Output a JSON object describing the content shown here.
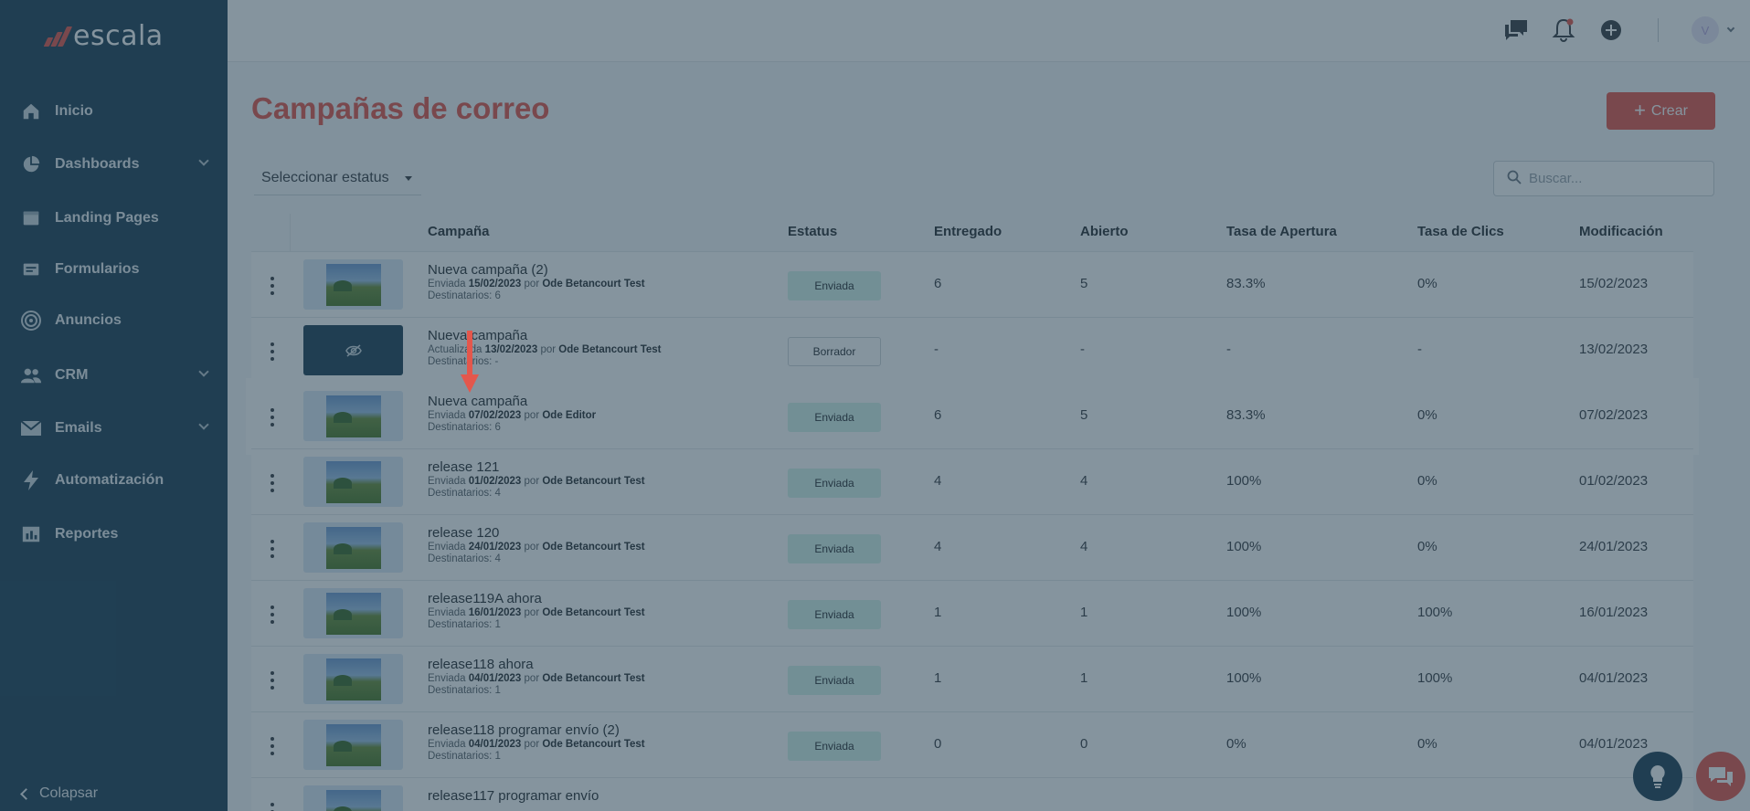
{
  "brand": {
    "name": "escala"
  },
  "sidebar": {
    "items": [
      {
        "label": "Inicio",
        "icon": "home-icon",
        "has_children": false
      },
      {
        "label": "Dashboards",
        "icon": "pie-chart-icon",
        "has_children": true
      },
      {
        "label": "Landing Pages",
        "icon": "browser-window-icon",
        "has_children": false
      },
      {
        "label": "Formularios",
        "icon": "form-icon",
        "has_children": false
      },
      {
        "label": "Anuncios",
        "icon": "target-icon",
        "has_children": false
      },
      {
        "label": "CRM",
        "icon": "people-icon",
        "has_children": true
      },
      {
        "label": "Emails",
        "icon": "envelope-icon",
        "has_children": true
      },
      {
        "label": "Automatización",
        "icon": "lightning-icon",
        "has_children": false
      },
      {
        "label": "Reportes",
        "icon": "bar-report-icon",
        "has_children": false
      }
    ],
    "collapse_label": "Colapsar"
  },
  "header": {
    "avatar_initial": "V"
  },
  "page": {
    "title": "Campañas de correo",
    "create_label": "Crear",
    "status_filter": "Seleccionar estatus",
    "search_placeholder": "Buscar..."
  },
  "table": {
    "columns": [
      "Campaña",
      "Estatus",
      "Entregado",
      "Abierto",
      "Tasa de Apertura",
      "Tasa de Clics",
      "Modificación"
    ],
    "rows": [
      {
        "name": "Nueva campaña (2)",
        "action": "Enviada",
        "date": "15/02/2023",
        "by": "por",
        "author": "Ode Betancourt Test",
        "recipients": "Destinatarios: 6",
        "status": "Enviada",
        "delivered": "6",
        "opened": "5",
        "open_rate": "83.3%",
        "click_rate": "0%",
        "modified": "15/02/2023"
      },
      {
        "name": "Nueva campaña",
        "action": "Actualizada",
        "date": "13/02/2023",
        "by": "por",
        "author": "Ode Betancourt Test",
        "recipients": "Destinatarios: -",
        "status": "Borrador",
        "delivered": "-",
        "opened": "-",
        "open_rate": "-",
        "click_rate": "-",
        "modified": "13/02/2023"
      },
      {
        "name": "Nueva campaña",
        "action": "Enviada",
        "date": "07/02/2023",
        "by": "por",
        "author": "Ode Editor",
        "recipients": "Destinatarios: 6",
        "status": "Enviada",
        "delivered": "6",
        "opened": "5",
        "open_rate": "83.3%",
        "click_rate": "0%",
        "modified": "07/02/2023"
      },
      {
        "name": "release 121",
        "action": "Enviada",
        "date": "01/02/2023",
        "by": "por",
        "author": "Ode Betancourt Test",
        "recipients": "Destinatarios: 4",
        "status": "Enviada",
        "delivered": "4",
        "opened": "4",
        "open_rate": "100%",
        "click_rate": "0%",
        "modified": "01/02/2023"
      },
      {
        "name": "release 120",
        "action": "Enviada",
        "date": "24/01/2023",
        "by": "por",
        "author": "Ode Betancourt Test",
        "recipients": "Destinatarios: 4",
        "status": "Enviada",
        "delivered": "4",
        "opened": "4",
        "open_rate": "100%",
        "click_rate": "0%",
        "modified": "24/01/2023"
      },
      {
        "name": "release119A ahora",
        "action": "Enviada",
        "date": "16/01/2023",
        "by": "por",
        "author": "Ode Betancourt Test",
        "recipients": "Destinatarios: 1",
        "status": "Enviada",
        "delivered": "1",
        "opened": "1",
        "open_rate": "100%",
        "click_rate": "100%",
        "modified": "16/01/2023"
      },
      {
        "name": "release118 ahora",
        "action": "Enviada",
        "date": "04/01/2023",
        "by": "por",
        "author": "Ode Betancourt Test",
        "recipients": "Destinatarios: 1",
        "status": "Enviada",
        "delivered": "1",
        "opened": "1",
        "open_rate": "100%",
        "click_rate": "100%",
        "modified": "04/01/2023"
      },
      {
        "name": "release118 programar envío (2)",
        "action": "Enviada",
        "date": "04/01/2023",
        "by": "por",
        "author": "Ode Betancourt Test",
        "recipients": "Destinatarios: 1",
        "status": "Enviada",
        "delivered": "0",
        "opened": "0",
        "open_rate": "0%",
        "click_rate": "0%",
        "modified": "04/01/2023"
      },
      {
        "name": "release117 programar envío",
        "action": "",
        "date": "",
        "by": "",
        "author": "",
        "recipients": "",
        "status": "",
        "delivered": "",
        "opened": "",
        "open_rate": "",
        "click_rate": "",
        "modified": ""
      }
    ],
    "highlighted_row": 2
  },
  "colors": {
    "brand_red": "#e4574c",
    "sidebar_bg": "#1f4258",
    "badge_sent_bg": "#d4f3ec",
    "overlay": "rgba(32,60,78,0.55)"
  }
}
